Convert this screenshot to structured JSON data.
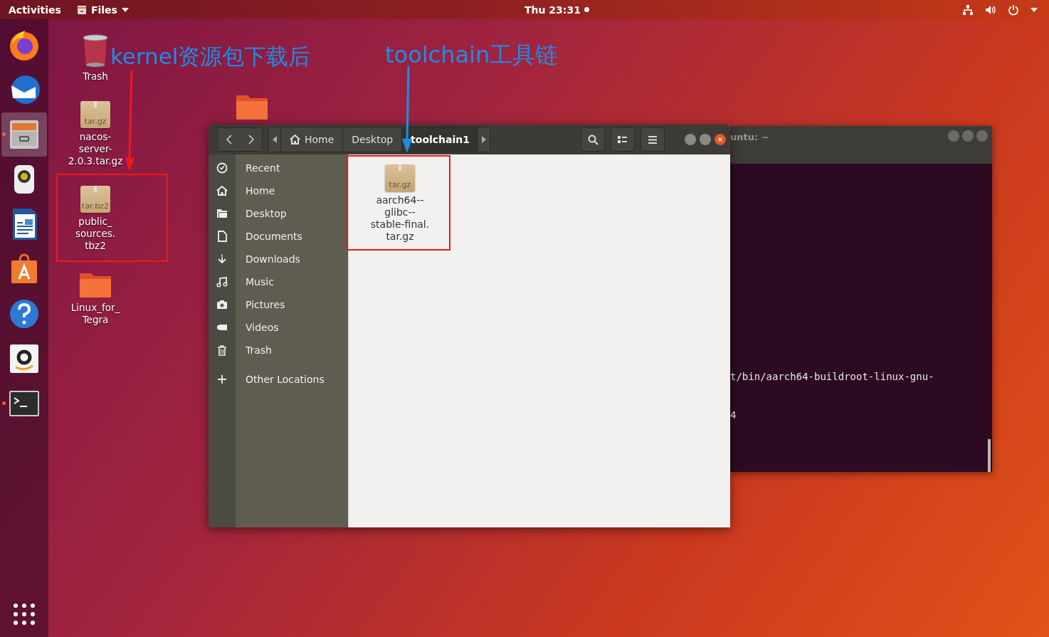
{
  "top_bar": {
    "activities": "Activities",
    "app_menu": "Files",
    "clock": "Thu 23:31"
  },
  "dock": [
    {
      "kind": "firefox",
      "selected": false,
      "running": false
    },
    {
      "kind": "mail",
      "selected": false,
      "running": false
    },
    {
      "kind": "files",
      "selected": true,
      "running": true
    },
    {
      "kind": "speaker",
      "selected": false,
      "running": false
    },
    {
      "kind": "writer",
      "selected": false,
      "running": false
    },
    {
      "kind": "store",
      "selected": false,
      "running": false
    },
    {
      "kind": "help",
      "selected": false,
      "running": false
    },
    {
      "kind": "amazon",
      "selected": false,
      "running": false
    },
    {
      "kind": "terminal",
      "selected": false,
      "running": true
    }
  ],
  "desktop_icons": [
    {
      "kind": "trash",
      "label": "Trash"
    },
    {
      "kind": "archive",
      "badge": "tar.gz",
      "label": "nacos-\nserver-\n2.0.3.tar.gz"
    },
    {
      "kind": "archive",
      "badge": "tar.bz2",
      "label": "public_\nsources.\ntbz2"
    },
    {
      "kind": "folder",
      "label": "Linux_for_\nTegra"
    }
  ],
  "terminal": {
    "title": "untu: ~",
    "lines": [
      "t/bin/aarch64-buildroot-linux-gnu-",
      "4"
    ]
  },
  "files_window": {
    "path": [
      {
        "label": "Home",
        "kind": "home",
        "selected": false
      },
      {
        "label": "Desktop",
        "kind": "plain",
        "selected": false
      },
      {
        "label": "toolchain1",
        "kind": "plain",
        "selected": true
      }
    ],
    "sidebar": [
      {
        "kind": "recent",
        "label": "Recent",
        "selected": false
      },
      {
        "kind": "home",
        "label": "Home",
        "selected": false
      },
      {
        "kind": "desktop",
        "label": "Desktop",
        "selected": false
      },
      {
        "kind": "documents",
        "label": "Documents",
        "selected": false
      },
      {
        "kind": "downloads",
        "label": "Downloads",
        "selected": false
      },
      {
        "kind": "music",
        "label": "Music",
        "selected": false
      },
      {
        "kind": "pictures",
        "label": "Pictures",
        "selected": false
      },
      {
        "kind": "videos",
        "label": "Videos",
        "selected": false
      },
      {
        "kind": "trash",
        "label": "Trash",
        "selected": false
      }
    ],
    "other_locations": "Other Locations",
    "files": [
      {
        "kind": "archive",
        "badge": "tar.gz",
        "label": "aarch64--\nglibc--\nstable-final.\ntar.gz",
        "selected": false
      }
    ]
  },
  "annotations": [
    "kernel资源包下载后",
    "toolchain工具链"
  ]
}
